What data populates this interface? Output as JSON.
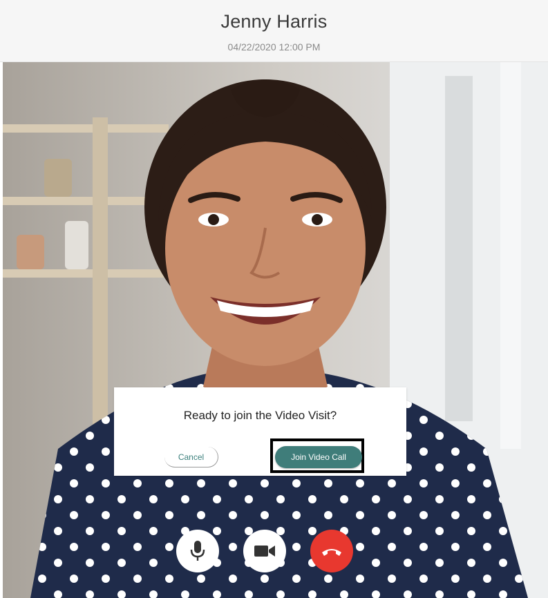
{
  "header": {
    "name": "Jenny Harris",
    "datetime": "04/22/2020 12:00 PM"
  },
  "dialog": {
    "prompt": "Ready to join the Video Visit?",
    "cancel_label": "Cancel",
    "join_label": "Join Video Call"
  },
  "controls": {
    "mic_icon": "microphone-icon",
    "camera_icon": "video-camera-icon",
    "end_icon": "hang-up-icon"
  },
  "colors": {
    "accent": "#3f7d7a",
    "end_call": "#e8382f"
  }
}
